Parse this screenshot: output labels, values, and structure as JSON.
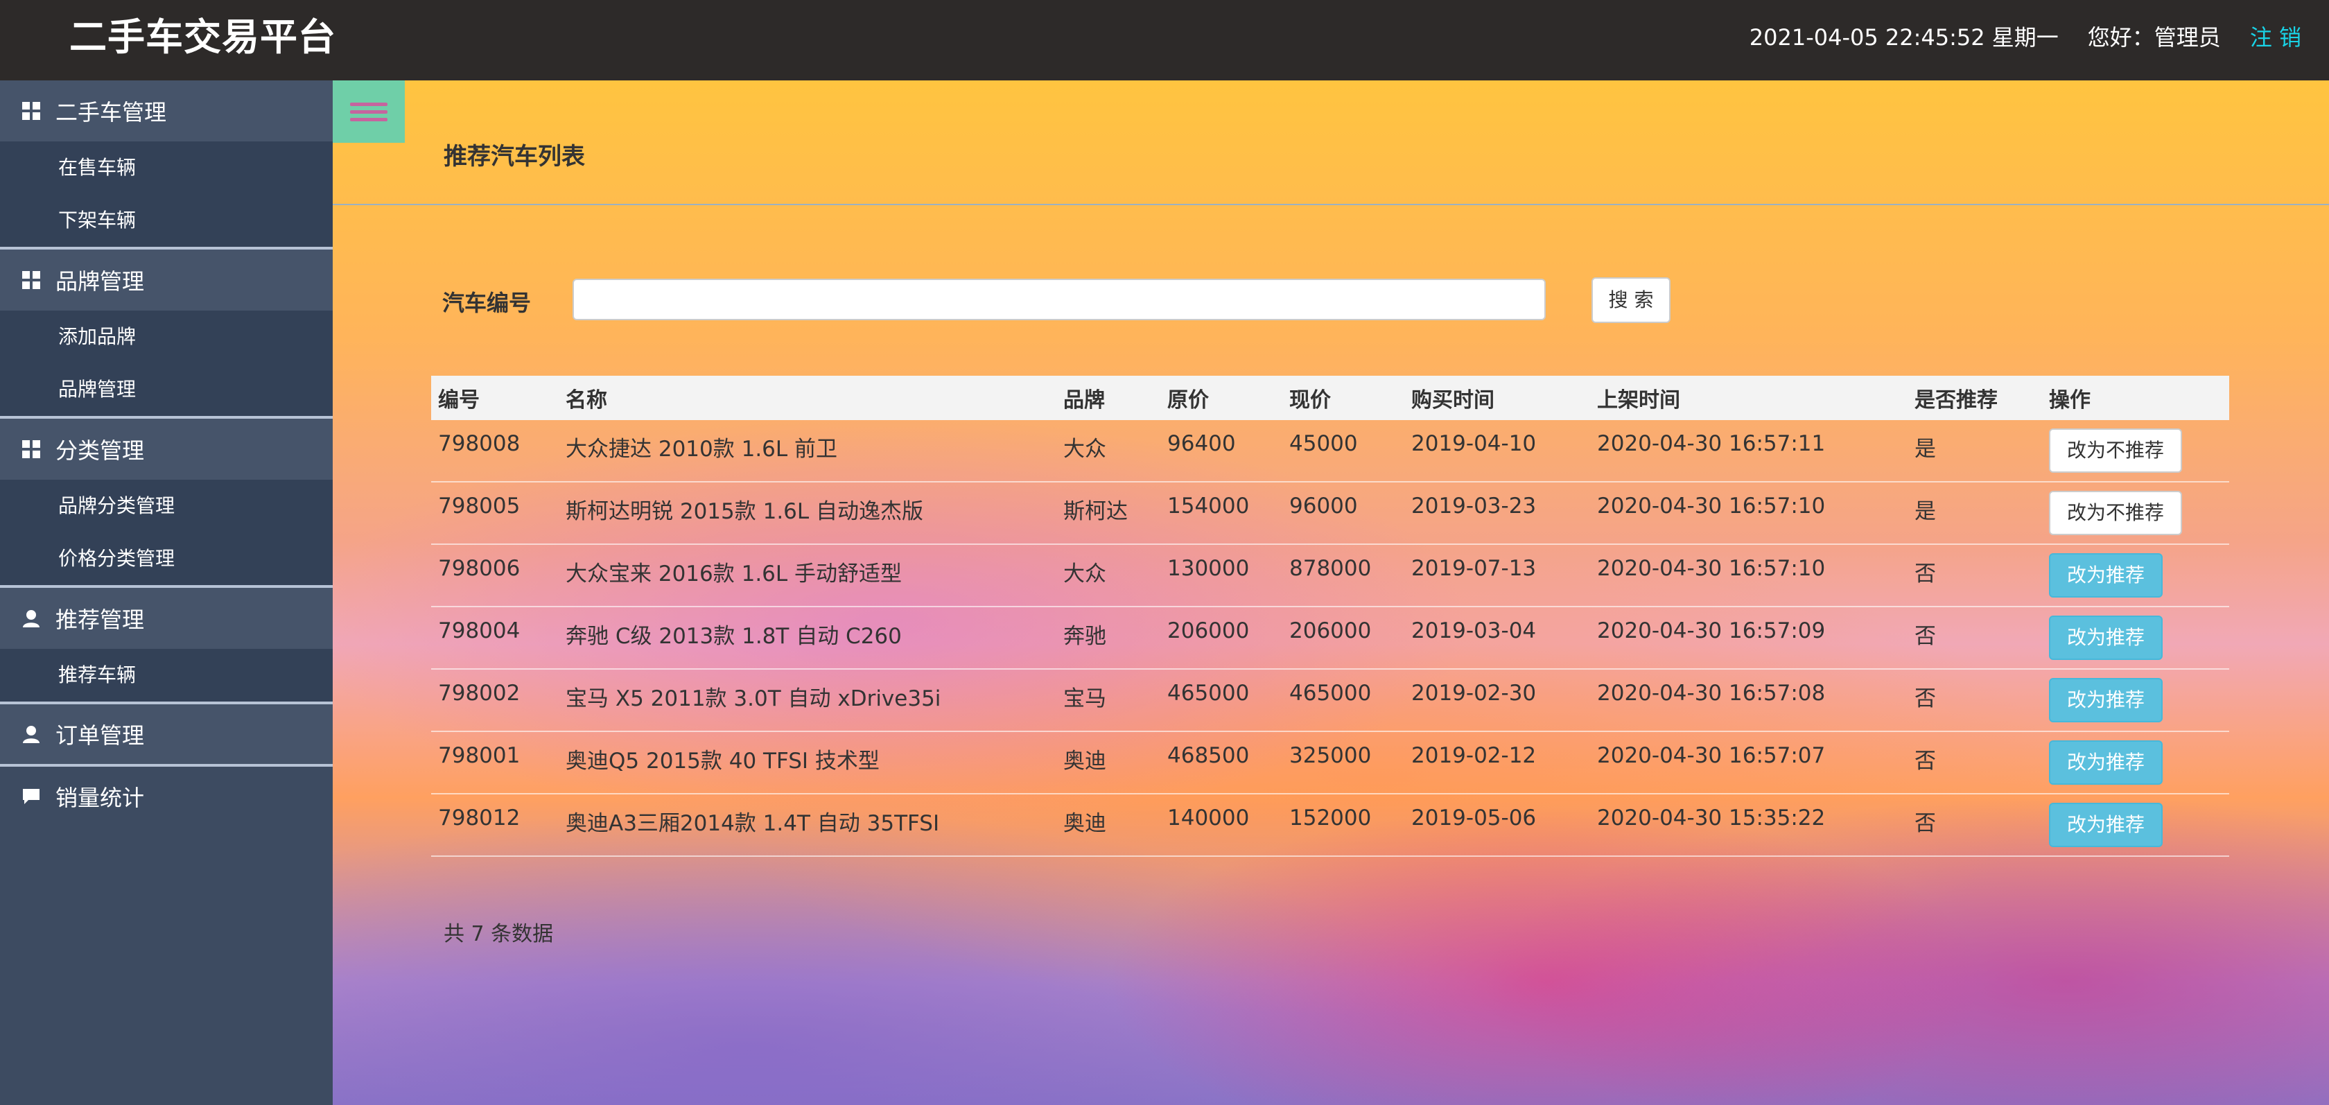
{
  "header": {
    "title": "二手车交易平台",
    "datetime": "2021-04-05 22:45:52 星期一",
    "greeting": "您好：管理员",
    "logout": "注 销"
  },
  "sidebar": {
    "groups": [
      {
        "label": "二手车管理",
        "icon": "grid-icon",
        "items": [
          "在售车辆",
          "下架车辆"
        ]
      },
      {
        "label": "品牌管理",
        "icon": "grid-icon",
        "items": [
          "添加品牌",
          "品牌管理"
        ]
      },
      {
        "label": "分类管理",
        "icon": "grid-icon",
        "items": [
          "品牌分类管理",
          "价格分类管理"
        ]
      },
      {
        "label": "推荐管理",
        "icon": "user-icon",
        "items": [
          "推荐车辆"
        ]
      },
      {
        "label": "订单管理",
        "icon": "user-icon",
        "items": []
      },
      {
        "label": "销量统计",
        "icon": "comment-icon",
        "items": []
      }
    ]
  },
  "main": {
    "page_title": "推荐汽车列表",
    "search": {
      "label": "汽车编号",
      "value": "",
      "button": "搜 索"
    },
    "table": {
      "headers": [
        "编号",
        "名称",
        "品牌",
        "原价",
        "现价",
        "购买时间",
        "上架时间",
        "是否推荐",
        "操作"
      ],
      "rows": [
        {
          "id": "798008",
          "name": "大众捷达 2010款 1.6L 前卫",
          "brand": "大众",
          "orig": "96400",
          "cur": "45000",
          "bought": "2019-04-10",
          "listed": "2020-04-30 16:57:11",
          "rec": "是",
          "action": "改为不推荐"
        },
        {
          "id": "798005",
          "name": "斯柯达明锐 2015款 1.6L 自动逸杰版",
          "brand": "斯柯达",
          "orig": "154000",
          "cur": "96000",
          "bought": "2019-03-23",
          "listed": "2020-04-30 16:57:10",
          "rec": "是",
          "action": "改为不推荐"
        },
        {
          "id": "798006",
          "name": "大众宝来 2016款 1.6L 手动舒适型",
          "brand": "大众",
          "orig": "130000",
          "cur": "878000",
          "bought": "2019-07-13",
          "listed": "2020-04-30 16:57:10",
          "rec": "否",
          "action": "改为推荐"
        },
        {
          "id": "798004",
          "name": "奔驰 C级 2013款 1.8T 自动 C260",
          "brand": "奔驰",
          "orig": "206000",
          "cur": "206000",
          "bought": "2019-03-04",
          "listed": "2020-04-30 16:57:09",
          "rec": "否",
          "action": "改为推荐"
        },
        {
          "id": "798002",
          "name": "宝马 X5 2011款 3.0T 自动 xDrive35i",
          "brand": "宝马",
          "orig": "465000",
          "cur": "465000",
          "bought": "2019-02-30",
          "listed": "2020-04-30 16:57:08",
          "rec": "否",
          "action": "改为推荐"
        },
        {
          "id": "798001",
          "name": "奥迪Q5 2015款 40 TFSI 技术型",
          "brand": "奥迪",
          "orig": "468500",
          "cur": "325000",
          "bought": "2019-02-12",
          "listed": "2020-04-30 16:57:07",
          "rec": "否",
          "action": "改为推荐"
        },
        {
          "id": "798012",
          "name": "奥迪A3三厢2014款 1.4T 自动 35TFSI",
          "brand": "奥迪",
          "orig": "140000",
          "cur": "152000",
          "bought": "2019-05-06",
          "listed": "2020-04-30 15:35:22",
          "rec": "否",
          "action": "改为推荐"
        }
      ]
    },
    "total": "共 7 条数据"
  },
  "colors": {
    "topbar": "#2d2a29",
    "sidebar": "#3d4b61",
    "accent_logout": "#19d3e6",
    "recommend_button": "#5bc0de"
  }
}
